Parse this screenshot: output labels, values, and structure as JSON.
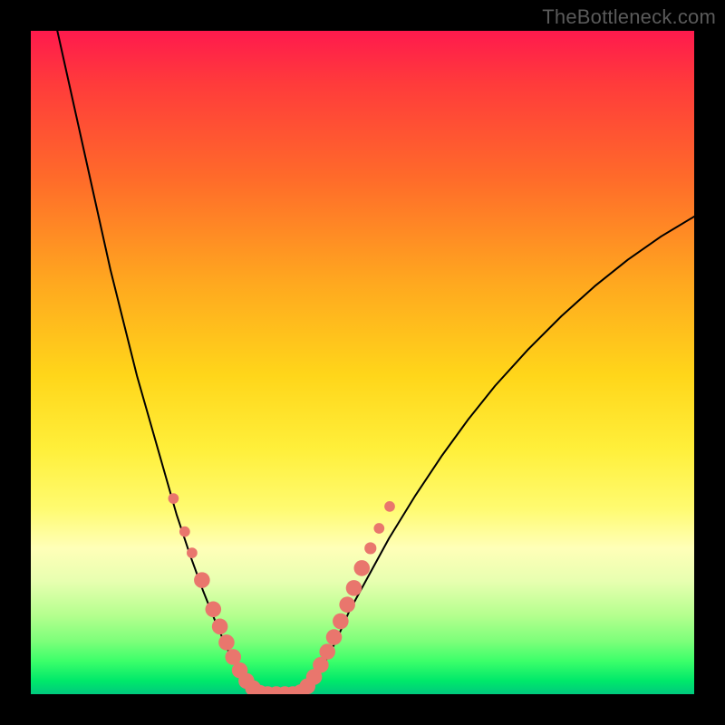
{
  "watermark": "TheBottleneck.com",
  "chart_data": {
    "type": "line",
    "title": "",
    "xlabel": "",
    "ylabel": "",
    "xlim": [
      0,
      100
    ],
    "ylim": [
      0,
      100
    ],
    "series": [
      {
        "name": "curve-left",
        "x": [
          4,
          6,
          8,
          10,
          12,
          14,
          16,
          18,
          20,
          22,
          24,
          26,
          28,
          30,
          31.5,
          33,
          34.5
        ],
        "y": [
          100,
          91,
          82,
          73,
          64,
          56,
          48,
          41,
          34,
          27,
          21,
          15.5,
          10.5,
          6,
          3.2,
          1.1,
          0
        ]
      },
      {
        "name": "curve-flat",
        "x": [
          34.5,
          36,
          37.5,
          39,
          40.5
        ],
        "y": [
          0,
          0,
          0,
          0,
          0
        ]
      },
      {
        "name": "curve-right",
        "x": [
          40.5,
          42,
          44,
          46,
          48,
          51,
          54,
          58,
          62,
          66,
          70,
          75,
          80,
          85,
          90,
          95,
          100
        ],
        "y": [
          0,
          1.4,
          4.2,
          8,
          12.5,
          18,
          23.5,
          30,
          36,
          41.5,
          46.5,
          52,
          57,
          61.5,
          65.5,
          69,
          72
        ]
      }
    ],
    "markers": [
      {
        "cx": 21.5,
        "cy": 29.5,
        "r": 0.8
      },
      {
        "cx": 23.2,
        "cy": 24.5,
        "r": 0.8
      },
      {
        "cx": 24.3,
        "cy": 21.3,
        "r": 0.8
      },
      {
        "cx": 25.8,
        "cy": 17.2,
        "r": 1.2
      },
      {
        "cx": 27.5,
        "cy": 12.8,
        "r": 1.2
      },
      {
        "cx": 28.5,
        "cy": 10.2,
        "r": 1.2
      },
      {
        "cx": 29.5,
        "cy": 7.8,
        "r": 1.2
      },
      {
        "cx": 30.5,
        "cy": 5.6,
        "r": 1.2
      },
      {
        "cx": 31.5,
        "cy": 3.6,
        "r": 1.2
      },
      {
        "cx": 32.5,
        "cy": 2.0,
        "r": 1.2
      },
      {
        "cx": 33.5,
        "cy": 0.9,
        "r": 1.2
      },
      {
        "cx": 34.5,
        "cy": 0.2,
        "r": 1.2
      },
      {
        "cx": 35.7,
        "cy": 0.0,
        "r": 1.2
      },
      {
        "cx": 37.0,
        "cy": 0.0,
        "r": 1.2
      },
      {
        "cx": 38.3,
        "cy": 0.0,
        "r": 1.2
      },
      {
        "cx": 39.5,
        "cy": 0.0,
        "r": 1.2
      },
      {
        "cx": 40.7,
        "cy": 0.3,
        "r": 1.2
      },
      {
        "cx": 41.7,
        "cy": 1.2,
        "r": 1.2
      },
      {
        "cx": 42.7,
        "cy": 2.6,
        "r": 1.2
      },
      {
        "cx": 43.7,
        "cy": 4.4,
        "r": 1.2
      },
      {
        "cx": 44.7,
        "cy": 6.4,
        "r": 1.2
      },
      {
        "cx": 45.7,
        "cy": 8.6,
        "r": 1.2
      },
      {
        "cx": 46.7,
        "cy": 11.0,
        "r": 1.2
      },
      {
        "cx": 47.7,
        "cy": 13.5,
        "r": 1.2
      },
      {
        "cx": 48.7,
        "cy": 16.0,
        "r": 1.2
      },
      {
        "cx": 49.9,
        "cy": 19.0,
        "r": 1.2
      },
      {
        "cx": 51.2,
        "cy": 22.0,
        "r": 0.9
      },
      {
        "cx": 52.5,
        "cy": 25.0,
        "r": 0.8
      },
      {
        "cx": 54.1,
        "cy": 28.3,
        "r": 0.8
      }
    ],
    "marker_color": "#e9766d"
  }
}
